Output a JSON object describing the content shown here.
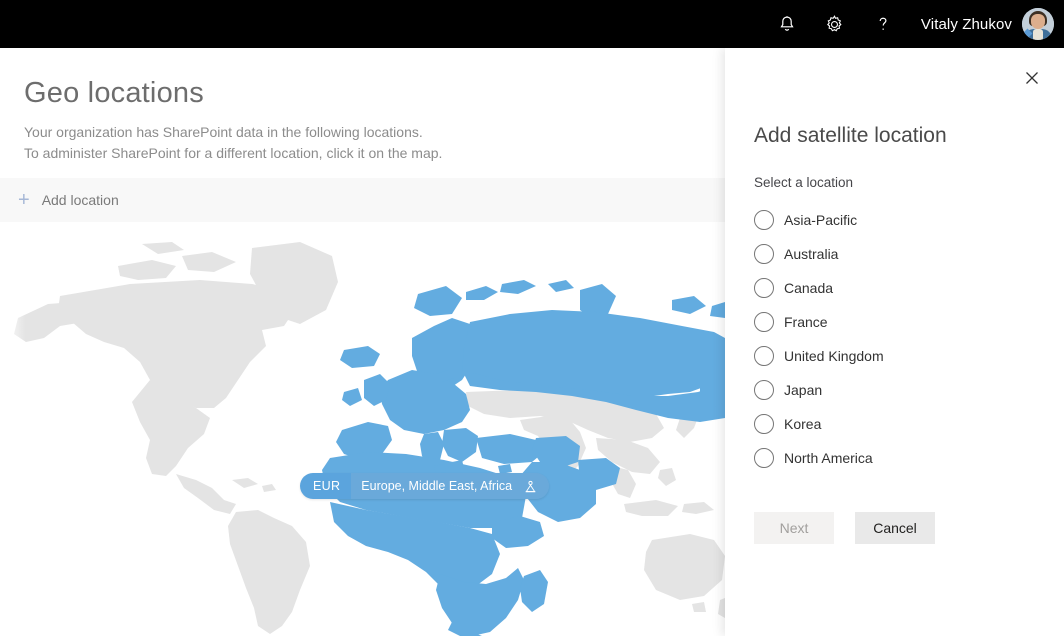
{
  "suite_bar": {
    "icons": [
      {
        "name": "notification-bell-icon",
        "title": "Notifications"
      },
      {
        "name": "gear-icon",
        "title": "Settings"
      },
      {
        "name": "help-question-icon",
        "title": "Help"
      }
    ],
    "user_name": "Vitaly Zhukov",
    "avatar_alt": "Vitaly Zhukov"
  },
  "page": {
    "title": "Geo locations",
    "description_line1": "Your organization has SharePoint data in the following locations.",
    "description_line2": "To administer SharePoint for a different location, click it on the map."
  },
  "command_bar": {
    "add_location_label": "Add location",
    "add_icon": "plus-icon"
  },
  "map": {
    "pill": {
      "code": "EUR",
      "name": "Europe, Middle East, Africa",
      "home_icon": "home-location-icon"
    },
    "colors": {
      "land": "#e4e4e4",
      "highlight": "#63ace0",
      "pill_code_bg": "#5ba4dd",
      "pill_name_bg": "#6aa9da",
      "ocean": "#ffffff"
    }
  },
  "panel": {
    "close_icon": "close-icon",
    "title": "Add satellite location",
    "select_label": "Select a location",
    "locations": [
      {
        "label": "Asia-Pacific",
        "selected": false
      },
      {
        "label": "Australia",
        "selected": false
      },
      {
        "label": "Canada",
        "selected": false
      },
      {
        "label": "France",
        "selected": false
      },
      {
        "label": "United Kingdom",
        "selected": false
      },
      {
        "label": "Japan",
        "selected": false
      },
      {
        "label": "Korea",
        "selected": false
      },
      {
        "label": "North America",
        "selected": false
      }
    ],
    "next_label": "Next",
    "next_disabled": true,
    "cancel_label": "Cancel"
  }
}
